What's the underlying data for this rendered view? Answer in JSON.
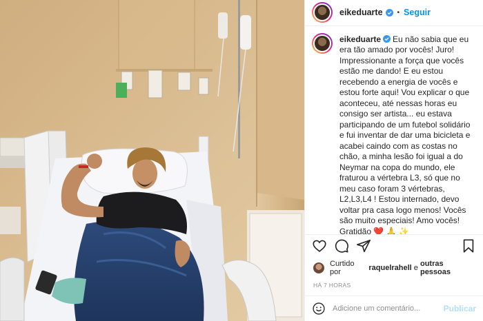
{
  "header": {
    "username": "eikeduarte",
    "verified": true,
    "separator": "•",
    "follow_label": "Seguir",
    "verified_color": "#3897f0",
    "follow_color": "#0095f6"
  },
  "caption": {
    "username": "eikeduarte",
    "text": "Eu não sabia que eu era tão amado por vocês! Juro! Impressionante a força que vocês estão me dando! E eu estou recebendo a energia de vocês e estou forte aqui! Vou explicar o que aconteceu, até nessas horas eu consigo ser artista... eu estava participando de um futebol solidário e fui inventar de dar uma bicicleta e acabei caindo com as costas no chão, a minha lesão foi igual a do Neymar na copa do mundo, ele fraturou a vértebra L3, só que no meu caso foram 3 vértebras, L2,L3,L4 ! Estou internado, devo voltar pra casa logo menos! Vocês são muito especiais! Amo vocês! Gratidão ❤️ 🙏 ✨",
    "time_ago": "7 h"
  },
  "actions": {
    "icons": [
      "heart-icon",
      "comment-icon",
      "share-icon",
      "bookmark-icon"
    ]
  },
  "likes": {
    "prefix": "Curtido por",
    "user": "raquelrahell",
    "suffix": "e",
    "others": "outras pessoas"
  },
  "timestamp": "HÁ 7 HORAS",
  "comment": {
    "emoji_icon": "smiley-icon",
    "placeholder": "Adicione um comentário...",
    "publish_label": "Publicar",
    "publish_color": "#b2dffc"
  }
}
